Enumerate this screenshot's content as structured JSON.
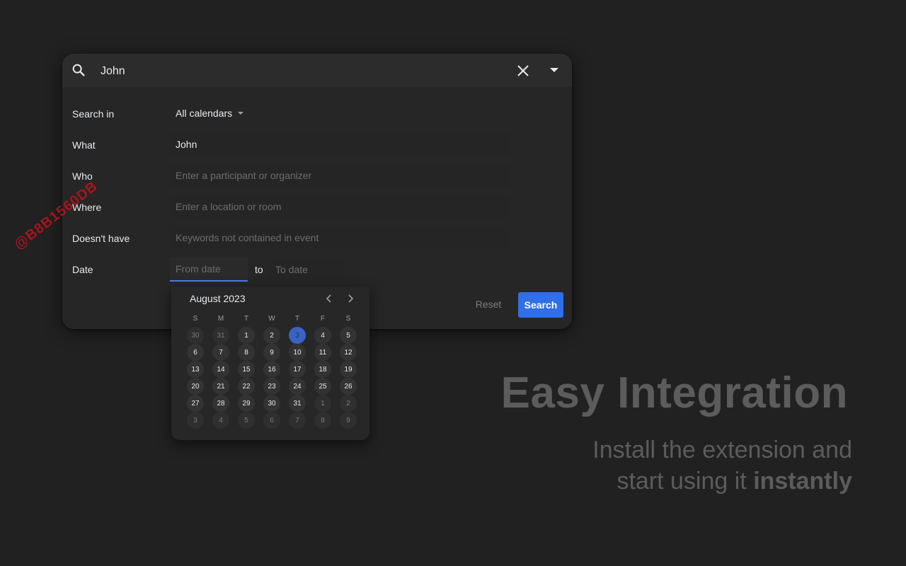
{
  "search": {
    "query": "John"
  },
  "form": {
    "search_in_label": "Search in",
    "search_in_value": "All calendars",
    "what_label": "What",
    "what_value": "John",
    "who_label": "Who",
    "who_placeholder": "Enter a participant or organizer",
    "where_label": "Where",
    "where_placeholder": "Enter a location or room",
    "doesnt_have_label": "Doesn't have",
    "doesnt_have_placeholder": "Keywords not contained in event",
    "date_label": "Date",
    "from_placeholder": "From date",
    "to_text": "to",
    "to_placeholder": "To date",
    "reset_label": "Reset",
    "search_label": "Search"
  },
  "picker": {
    "month": "August 2023",
    "weekdays": [
      "S",
      "M",
      "T",
      "W",
      "T",
      "F",
      "S"
    ],
    "weeks": [
      [
        {
          "d": "30",
          "m": true
        },
        {
          "d": "31",
          "m": true
        },
        {
          "d": "1"
        },
        {
          "d": "2"
        },
        {
          "d": "3",
          "sel": true
        },
        {
          "d": "4"
        },
        {
          "d": "5"
        }
      ],
      [
        {
          "d": "6"
        },
        {
          "d": "7"
        },
        {
          "d": "8"
        },
        {
          "d": "9"
        },
        {
          "d": "10"
        },
        {
          "d": "11"
        },
        {
          "d": "12"
        }
      ],
      [
        {
          "d": "13"
        },
        {
          "d": "14"
        },
        {
          "d": "15"
        },
        {
          "d": "16"
        },
        {
          "d": "17"
        },
        {
          "d": "18"
        },
        {
          "d": "19"
        }
      ],
      [
        {
          "d": "20"
        },
        {
          "d": "21"
        },
        {
          "d": "22"
        },
        {
          "d": "23"
        },
        {
          "d": "24"
        },
        {
          "d": "25"
        },
        {
          "d": "26"
        }
      ],
      [
        {
          "d": "27"
        },
        {
          "d": "28"
        },
        {
          "d": "29"
        },
        {
          "d": "30"
        },
        {
          "d": "31"
        },
        {
          "d": "1",
          "m": true
        },
        {
          "d": "2",
          "m": true
        }
      ],
      [
        {
          "d": "3",
          "m": true
        },
        {
          "d": "4",
          "m": true
        },
        {
          "d": "5",
          "m": true
        },
        {
          "d": "6",
          "m": true
        },
        {
          "d": "7",
          "m": true
        },
        {
          "d": "8",
          "m": true
        },
        {
          "d": "9",
          "m": true
        }
      ]
    ]
  },
  "watermark": "@B8B1560DB",
  "marketing": {
    "title": "Easy Integration",
    "line1": "Install the extension and",
    "line2_plain": "start using it ",
    "line2_bold": "instantly"
  },
  "colors": {
    "accent": "#2f6fe8",
    "selected_day": "#3b63c4",
    "watermark": "#b3151a"
  }
}
